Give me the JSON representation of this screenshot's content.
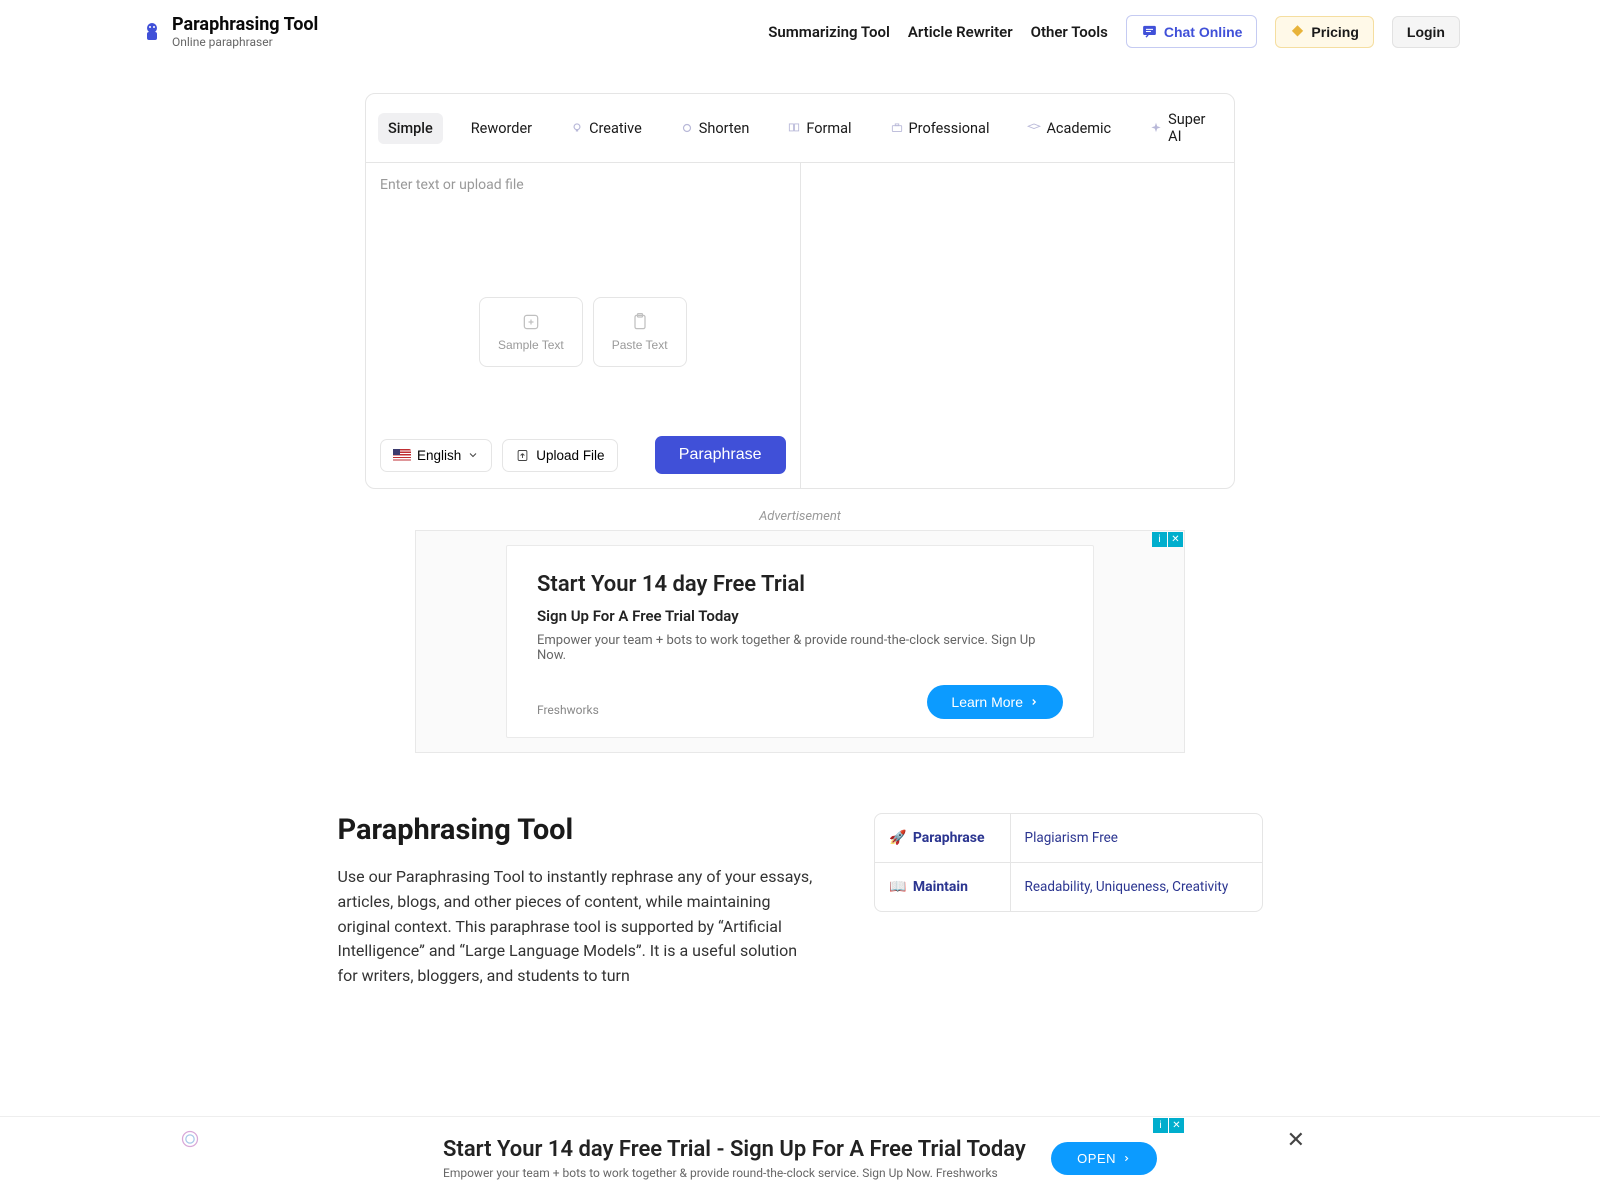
{
  "header": {
    "logo_title": "Paraphrasing Tool",
    "logo_subtitle": "Online paraphraser",
    "nav": {
      "summarizing": "Summarizing Tool",
      "rewriter": "Article Rewriter",
      "other": "Other Tools",
      "chat": "Chat Online",
      "pricing": "Pricing",
      "login": "Login"
    }
  },
  "tool": {
    "tabs": {
      "simple": "Simple",
      "reworder": "Reworder",
      "creative": "Creative",
      "shorten": "Shorten",
      "formal": "Formal",
      "professional": "Professional",
      "academic": "Academic",
      "superai": "Super AI"
    },
    "placeholder": "Enter text or upload file",
    "sample_text": "Sample Text",
    "paste_text": "Paste Text",
    "language": "English",
    "upload": "Upload File",
    "paraphrase": "Paraphrase"
  },
  "ad1": {
    "label": "Advertisement",
    "title": "Start Your 14 day Free Trial",
    "subtitle": "Sign Up For A Free Trial Today",
    "description": "Empower your team + bots to work together & provide round-the-clock service. Sign Up Now.",
    "brand": "Freshworks",
    "cta": "Learn More"
  },
  "content": {
    "title": "Paraphrasing Tool",
    "text": "Use our Paraphrasing Tool to instantly rephrase any of your essays, articles, blogs, and other pieces of content, while maintaining original context. This paraphrase tool is supported by “Artificial Intelligence” and “Large Language Models”. It is a useful solution for writers, bloggers, and students to turn",
    "features": [
      {
        "icon": "🚀",
        "key": "Paraphrase",
        "val": "Plagiarism Free"
      },
      {
        "icon": "📖",
        "key": "Maintain",
        "val": "Readability, Uniqueness, Creativity"
      }
    ]
  },
  "ad2": {
    "title": "Start Your 14 day Free Trial - Sign Up For A Free Trial Today",
    "description": "Empower your team + bots to work together & provide round-the-clock service. Sign Up Now. Freshworks",
    "cta": "OPEN"
  }
}
